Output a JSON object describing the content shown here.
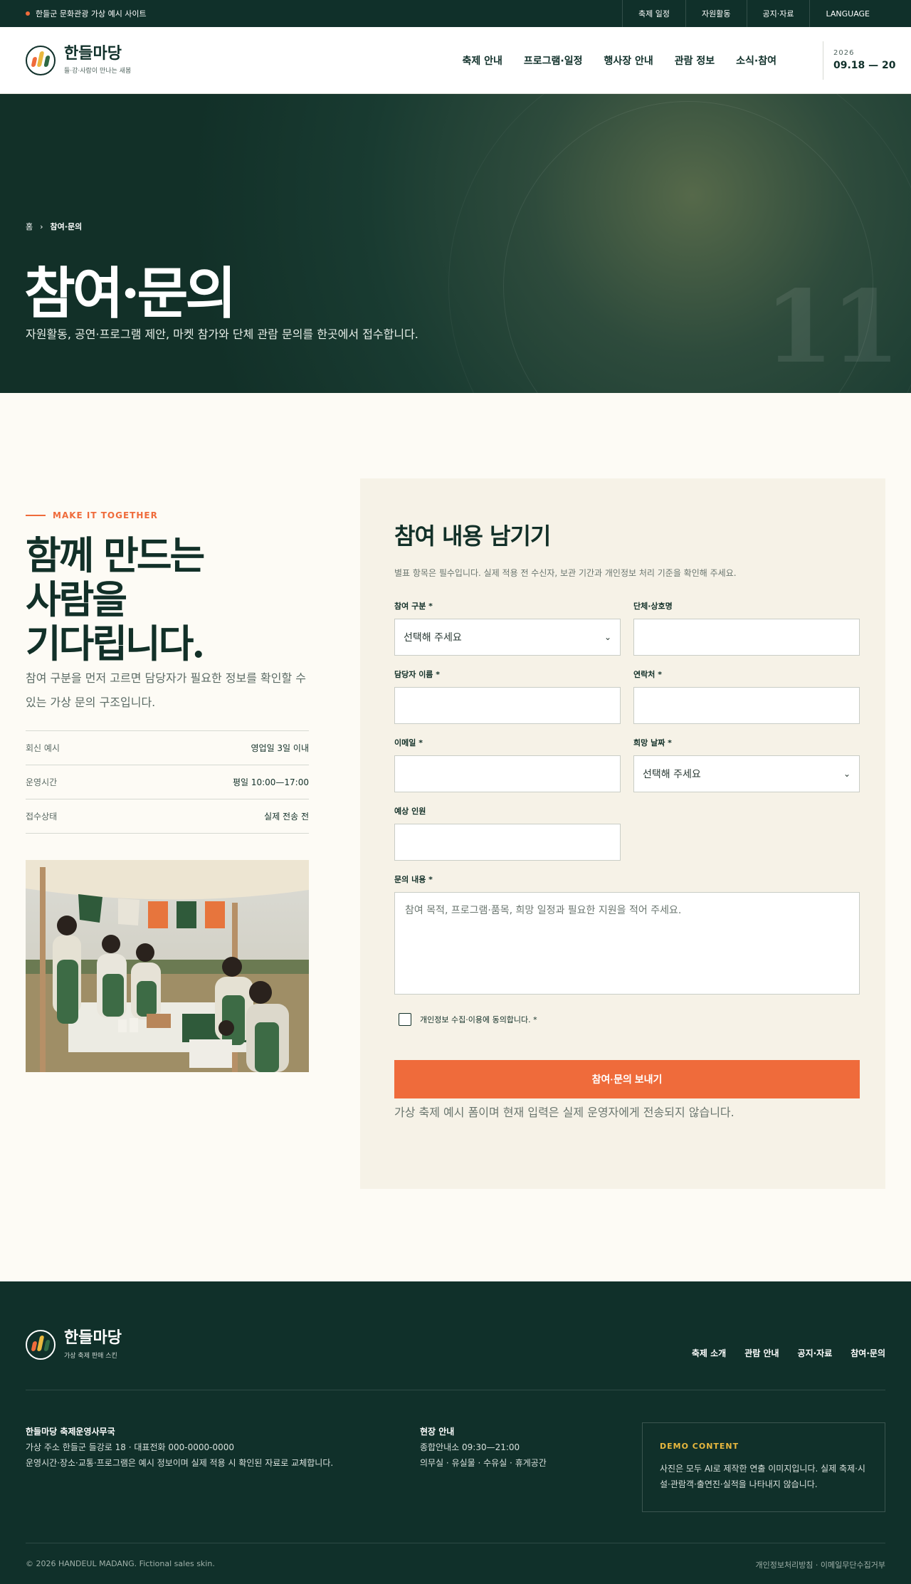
{
  "topbar": {
    "notice": "한들군 문화관광 가상 예시 사이트",
    "links": [
      "축제 일정",
      "자원활동",
      "공지·자료",
      "LANGUAGE"
    ]
  },
  "header": {
    "brand_name": "한들마당",
    "brand_sub": "들·강·사람이 만나는 새봄",
    "nav": [
      "축제 안내",
      "프로그램·일정",
      "행사장 안내",
      "관람 정보",
      "소식·참여"
    ],
    "year": "2026",
    "dates": "09.18 — 20"
  },
  "hero": {
    "breadcrumb_home": "홈",
    "breadcrumb_sep": "›",
    "breadcrumb_current": "참여·문의",
    "title": "참여·문의",
    "lead": "자원활동, 공연·프로그램 제안, 마켓 참가와 단체 관람 문의를 한곳에서 접수합니다.",
    "number": "11"
  },
  "intro": {
    "eyebrow": "MAKE IT TOGETHER",
    "heading_lines": [
      "함께 만드는",
      "사람을",
      "기다립니다."
    ],
    "description": "참여 구분을 먼저 고르면 담당자가 필요한 정보를 확인할 수 있는 가상 문의 구조입니다.",
    "info": [
      {
        "k": "회신 예시",
        "v": "영업일 3일 이내"
      },
      {
        "k": "운영시간",
        "v": "평일 10:00—17:00"
      },
      {
        "k": "접수상태",
        "v": "실제 전송 전"
      }
    ]
  },
  "form": {
    "title": "참여 내용 남기기",
    "hint": "별표 항목은 필수입니다. 실제 적용 전 수신자, 보관 기간과 개인정보 처리 기준을 확인해 주세요.",
    "category_label": "참여 구분 *",
    "category_value": "선택해 주세요",
    "org_label": "단체·상호명",
    "contact_name_label": "담당자 이름 *",
    "phone_label": "연락처 *",
    "email_label": "이메일 *",
    "date_label": "희망 날짜 *",
    "date_value": "선택해 주세요",
    "people_label": "예상 인원",
    "message_label": "문의 내용 *",
    "message_placeholder": "참여 목적, 프로그램·품목, 희망 일정과 필요한 지원을 적어 주세요.",
    "consent_label": "개인정보 수집·이용에 동의합니다. *",
    "submit_label": "참여·문의 보내기",
    "note": "가상 축제 예시 폼이며 현재 입력은 실제 운영자에게 전송되지 않습니다."
  },
  "footer": {
    "brand_name": "한들마당",
    "brand_sub": "가상 축제 판매 스킨",
    "nav": [
      "축제 소개",
      "관람 안내",
      "공지·자료",
      "참여·문의"
    ],
    "office_title": "한들마당 축제운영사무국",
    "office_line1": "가상 주소 한들군 들강로 18 · 대표전화 000-0000-0000",
    "office_line2": "운영시간·장소·교통·프로그램은 예시 정보이며 실제 적용 시 확인된 자료로 교체합니다.",
    "site_title": "현장 안내",
    "site_line1": "종합안내소 09:30—21:00",
    "site_line2": "의무실 · 유실물 · 수유실 · 휴게공간",
    "demo_title": "DEMO CONTENT",
    "demo_text": "사진은 모두 AI로 제작한 연출 이미지입니다. 실제 축제·시설·관람객·출연진·실적을 나타내지 않습니다.",
    "copyright": "© 2026 HANDEUL MADANG. Fictional sales skin.",
    "legal": "개인정보처리방침 · 이메일무단수집거부"
  },
  "colors": {
    "primary": "#10302a",
    "accent": "#ef6b3b",
    "demo_title": "#e9b83e",
    "cream": "#f6f2e7"
  },
  "icons": [
    "logo-mark",
    "chevron-down-icon",
    "checkbox"
  ]
}
